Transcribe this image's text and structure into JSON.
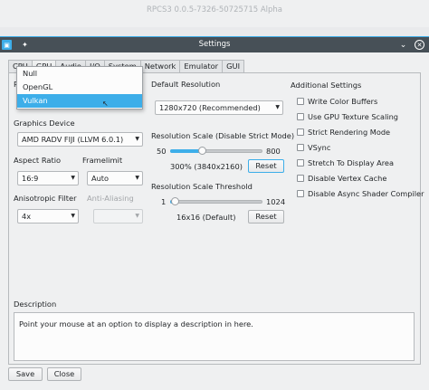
{
  "background_window": {
    "title": "RPCS3 0.0.5-7326-50725715 Alpha"
  },
  "dialog": {
    "title": "Settings",
    "tabs": [
      {
        "label": "CPU"
      },
      {
        "label": "GPU",
        "active": true
      },
      {
        "label": "Audio"
      },
      {
        "label": "I/O"
      },
      {
        "label": "System"
      },
      {
        "label": "Network"
      },
      {
        "label": "Emulator"
      },
      {
        "label": "GUI"
      }
    ],
    "renderer": {
      "label_partial": "R",
      "options": [
        "Null",
        "OpenGL",
        "Vulkan"
      ],
      "selected": "Vulkan"
    },
    "graphics_device": {
      "label": "Graphics Device",
      "value": "AMD RADV FIJI (LLVM 6.0.1)"
    },
    "aspect_ratio": {
      "label": "Aspect Ratio",
      "value": "16:9"
    },
    "framelimit": {
      "label": "Framelimit",
      "value": "Auto"
    },
    "anisotropic_filter": {
      "label": "Anisotropic Filter",
      "value": "4x"
    },
    "anti_aliasing": {
      "label": "Anti-Aliasing",
      "value": ""
    },
    "default_resolution": {
      "label": "Default Resolution",
      "value": "1280x720 (Recommended)"
    },
    "resolution_scale": {
      "label": "Resolution Scale (Disable Strict Mode)",
      "min": "50",
      "max": "800",
      "value": 300,
      "value_text": "300% (3840x2160)",
      "reset": "Reset"
    },
    "resolution_scale_threshold": {
      "label": "Resolution Scale Threshold",
      "min": "1",
      "max": "1024",
      "value": 16,
      "value_text": "16x16 (Default)",
      "reset": "Reset"
    },
    "additional_settings": {
      "label": "Additional Settings",
      "options": [
        {
          "label": "Write Color Buffers",
          "checked": false
        },
        {
          "label": "Use GPU Texture Scaling",
          "checked": false
        },
        {
          "label": "Strict Rendering Mode",
          "checked": false
        },
        {
          "label": "VSync",
          "checked": false
        },
        {
          "label": "Stretch To Display Area",
          "checked": false
        },
        {
          "label": "Disable Vertex Cache",
          "checked": false
        },
        {
          "label": "Disable Async Shader Compiler",
          "checked": false
        }
      ]
    },
    "description": {
      "label": "Description",
      "text": "Point your mouse at an option to display a description in here."
    },
    "buttons": {
      "save": "Save",
      "close": "Close"
    }
  },
  "colors": {
    "accent": "#3daee9",
    "titlebar": "#475057",
    "window_bg": "#eff0f1"
  }
}
